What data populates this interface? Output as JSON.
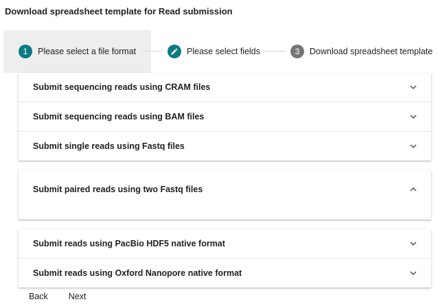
{
  "page": {
    "title": "Download spreadsheet template for Read submission"
  },
  "stepper": {
    "steps": [
      {
        "number": "1",
        "label": "Please select a file format",
        "state": "active",
        "color": "#0a7b83"
      },
      {
        "number": "",
        "label": "Please select fields",
        "state": "edit",
        "icon": "pencil-icon",
        "color": "#0a7b83"
      },
      {
        "number": "3",
        "label": "Download spreadsheet template",
        "state": "pending",
        "color": "#757575"
      }
    ]
  },
  "panels": [
    {
      "title": "Submit sequencing reads using CRAM files",
      "expanded": false,
      "icon": "chevron-down-icon"
    },
    {
      "title": "Submit sequencing reads using BAM files",
      "expanded": false,
      "icon": "chevron-down-icon"
    },
    {
      "title": "Submit single reads using Fastq files",
      "expanded": false,
      "icon": "chevron-down-icon"
    },
    {
      "title": "Submit paired reads using two Fastq files",
      "expanded": true,
      "icon": "chevron-up-icon"
    },
    {
      "title": "Submit reads using PacBio HDF5 native format",
      "expanded": false,
      "icon": "chevron-down-icon"
    },
    {
      "title": "Submit reads using Oxford Nanopore native format",
      "expanded": false,
      "icon": "chevron-down-icon"
    }
  ],
  "actions": {
    "back_label": "Back",
    "next_label": "Next"
  }
}
